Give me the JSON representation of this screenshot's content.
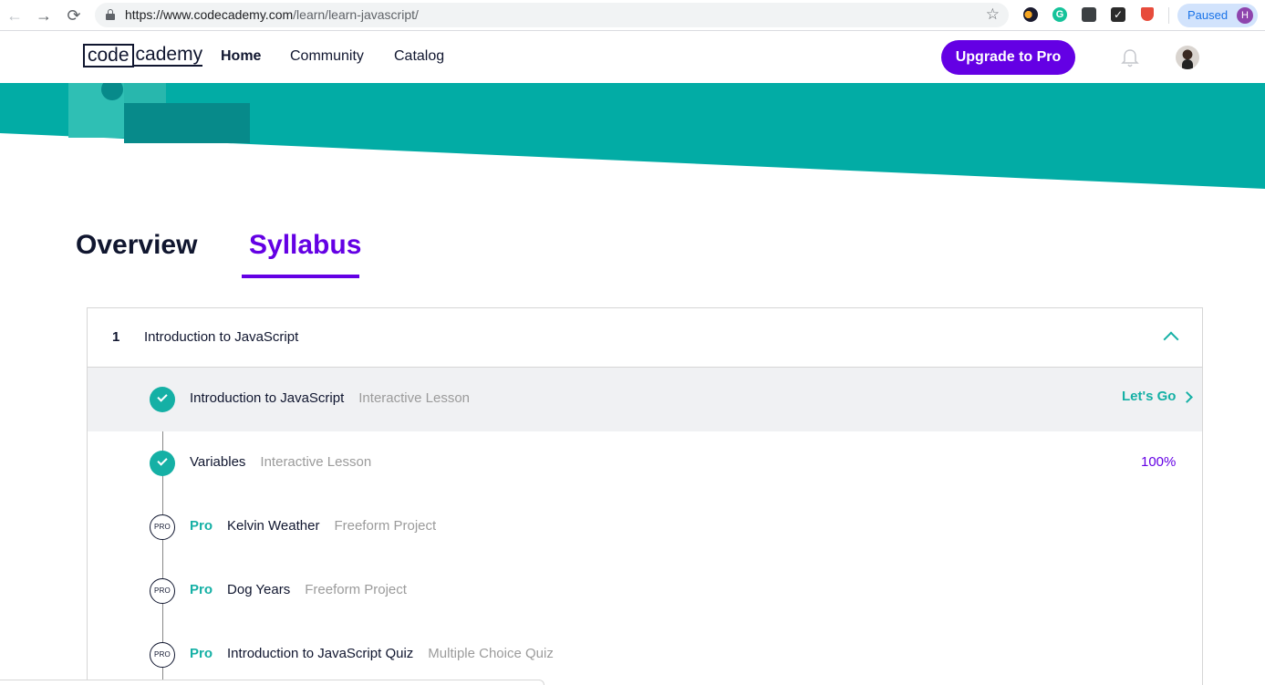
{
  "browser": {
    "url_host": "https://www.codecademy.com",
    "url_path": "/learn/learn-javascript/",
    "profile_status": "Paused",
    "profile_initial": "H"
  },
  "header": {
    "logo_code": "code",
    "logo_cademy": "cademy",
    "nav": {
      "home": "Home",
      "community": "Community",
      "catalog": "Catalog"
    },
    "upgrade_label": "Upgrade to Pro"
  },
  "tabs": {
    "overview": "Overview",
    "syllabus": "Syllabus"
  },
  "module": {
    "number": "1",
    "title": "Introduction to JavaScript",
    "items": [
      {
        "status": "complete",
        "name": "Introduction to JavaScript",
        "type": "Interactive Lesson",
        "action": "Let's Go"
      },
      {
        "status": "complete",
        "name": "Variables",
        "type": "Interactive Lesson",
        "progress": "100%"
      },
      {
        "status": "pro",
        "icon_label": "PRO",
        "pro_tag": "Pro",
        "name": "Kelvin Weather",
        "type": "Freeform Project"
      },
      {
        "status": "pro",
        "icon_label": "PRO",
        "pro_tag": "Pro",
        "name": "Dog Years",
        "type": "Freeform Project"
      },
      {
        "status": "pro",
        "icon_label": "PRO",
        "pro_tag": "Pro",
        "name": "Introduction to JavaScript Quiz",
        "type": "Multiple Choice Quiz"
      }
    ]
  },
  "colors": {
    "accent_teal": "#15b0a5",
    "hero_teal": "#02aca5",
    "brand_purple": "#6400e4",
    "navy": "#10162f"
  }
}
